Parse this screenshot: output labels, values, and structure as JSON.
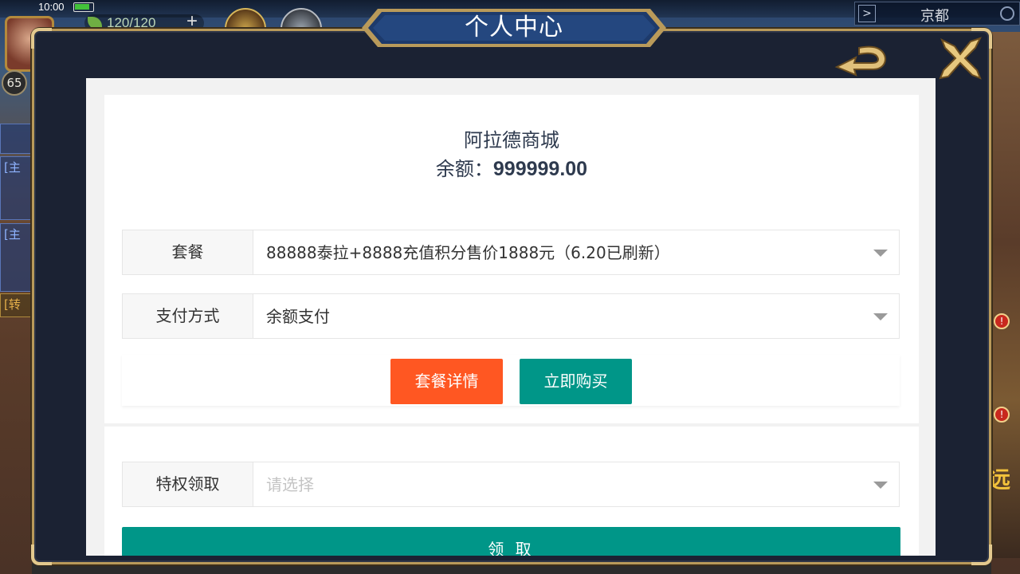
{
  "status_bar": {
    "time": "10:00"
  },
  "hud": {
    "energy": "120/120",
    "level": "65",
    "city": "京都",
    "side_cards": [
      "[主",
      "[主",
      "[主",
      "[转"
    ],
    "right_text": "远"
  },
  "dialog": {
    "title": "个人中心",
    "icons": {
      "back": "back-arrow-icon",
      "close": "close-x-icon"
    }
  },
  "shop": {
    "name": "阿拉德商城",
    "balance_label": "余额：",
    "balance_value": "999999.00"
  },
  "form": {
    "package": {
      "label": "套餐",
      "value": "88888泰拉+8888充值积分售价1888元（6.20已刷新）"
    },
    "payment": {
      "label": "支付方式",
      "value": "余额支付"
    },
    "details_button": "套餐详情",
    "buy_button": "立即购买"
  },
  "privilege": {
    "label": "特权领取",
    "placeholder": "请选择",
    "claim_button": "领 取"
  },
  "colors": {
    "orange": "#ff5722",
    "teal": "#009688",
    "frame_gold": "#b99a5a",
    "dialog_navy": "#1b2233"
  }
}
